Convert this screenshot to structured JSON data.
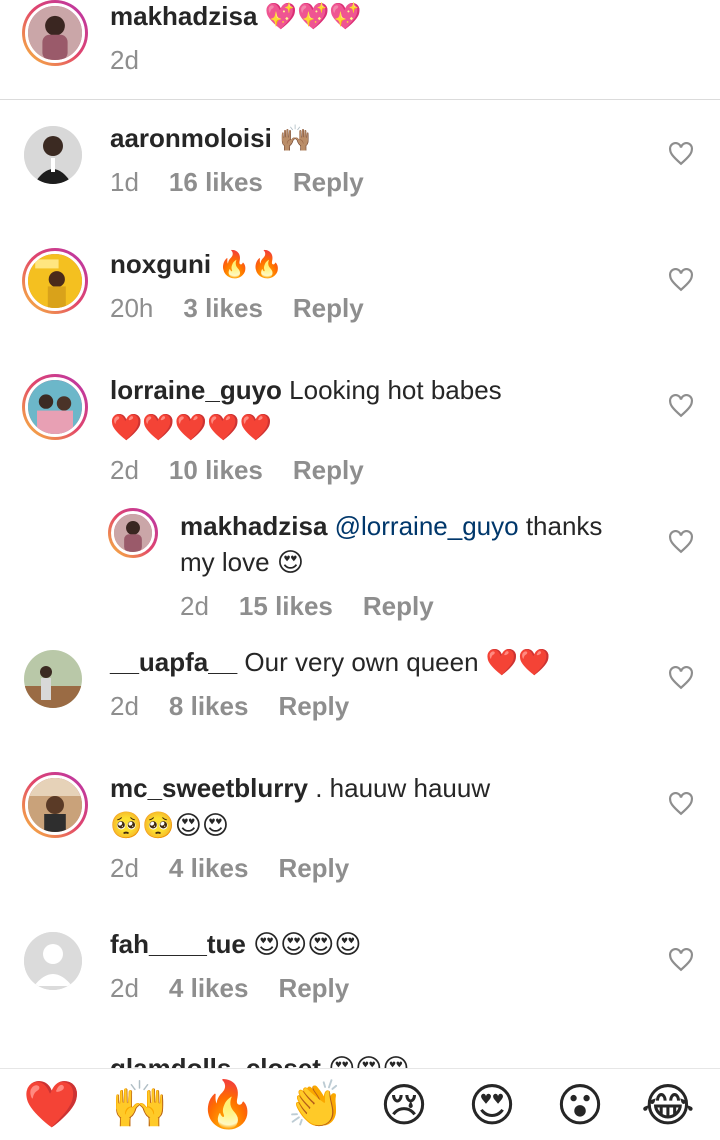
{
  "caption": {
    "username": "makhadzisa",
    "emoji": "💖💖💖",
    "time": "2d"
  },
  "comments": [
    {
      "username": "aaronmoloisi",
      "text": "",
      "emoji": "🙌🏽",
      "time": "1d",
      "likes": "16 likes",
      "reply": "Reply"
    },
    {
      "username": "noxguni",
      "text": "",
      "emoji": "🔥🔥",
      "time": "20h",
      "likes": "3 likes",
      "reply": "Reply"
    },
    {
      "username": "lorraine_guyo",
      "text": "Looking hot babes",
      "emoji": "❤️❤️❤️❤️❤️",
      "time": "2d",
      "likes": "10 likes",
      "reply": "Reply"
    },
    {
      "username": "makhadzisa",
      "mention": "@lorraine_guyo",
      "text": "thanks",
      "text2": "my love",
      "emoji": "😍",
      "time": "2d",
      "likes": "15 likes",
      "reply": "Reply"
    },
    {
      "username": "__uapfa__",
      "text": "Our very own queen",
      "emoji": "❤️❤️",
      "time": "2d",
      "likes": "8 likes",
      "reply": "Reply"
    },
    {
      "username": "mc_sweetblurry",
      "text": ". hauuw hauuw",
      "emoji": "🥺🥺😍😍",
      "time": "2d",
      "likes": "4 likes",
      "reply": "Reply"
    },
    {
      "username": "fah____tue",
      "text": "",
      "emoji": "😍😍😍😍",
      "time": "2d",
      "likes": "4 likes",
      "reply": "Reply"
    }
  ],
  "partial_row": {
    "username": "glamdolls_closet",
    "emoji": "😍😍😍"
  },
  "reactions": [
    "❤️",
    "🙌",
    "🔥",
    "👏",
    "😢",
    "😍",
    "😮",
    "😂"
  ],
  "icons": {
    "like": "heart-outline-icon"
  },
  "colors": {
    "text": "#262626",
    "meta": "#8e8e8e",
    "mention": "#00376b",
    "divider": "#dbdbdb"
  }
}
